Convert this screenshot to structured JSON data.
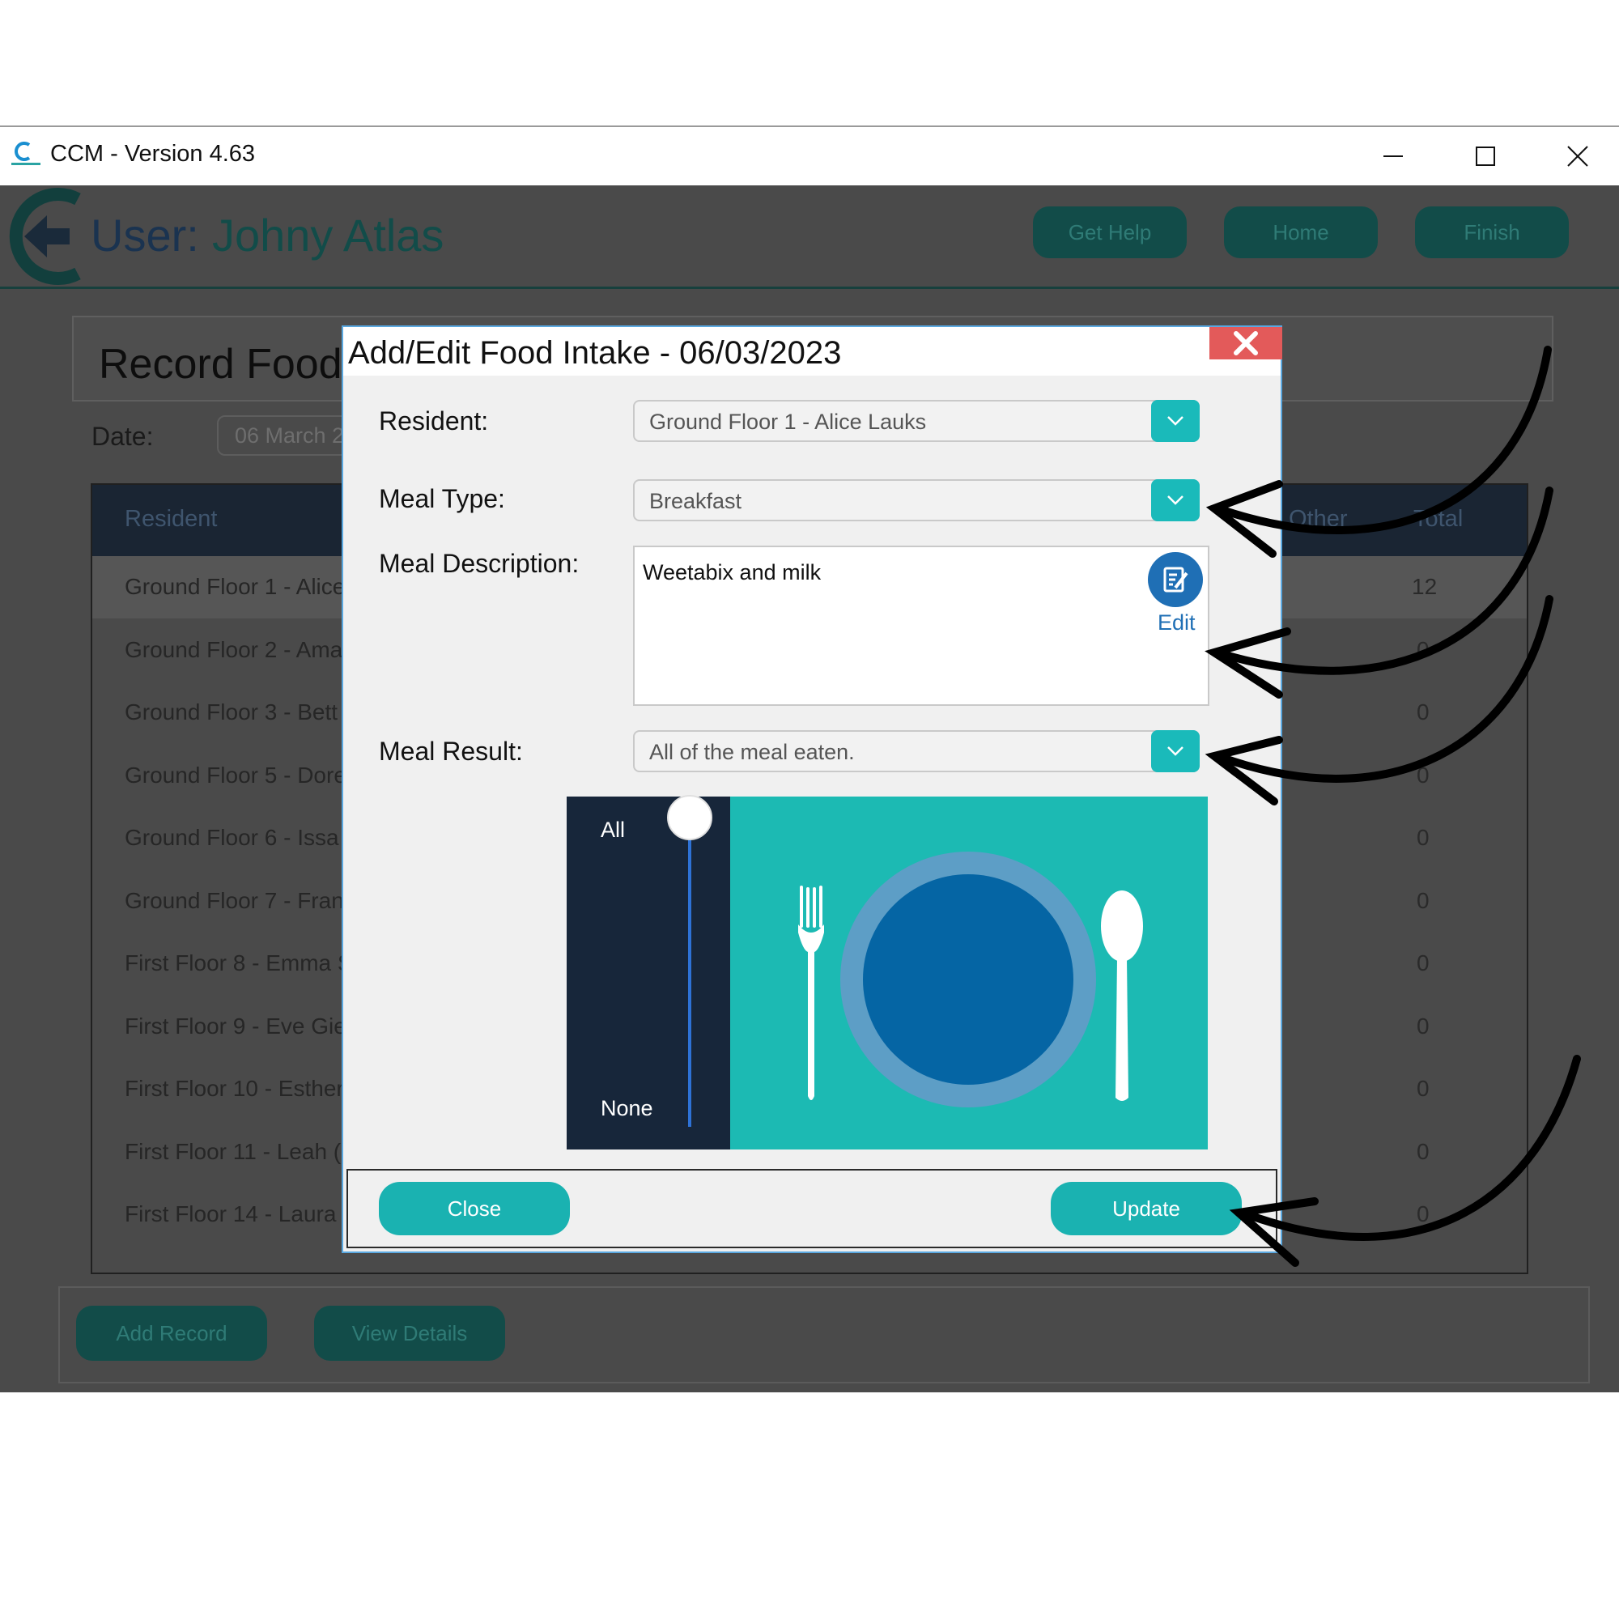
{
  "window": {
    "title": "CCM - Version 4.63",
    "controls": [
      "minimize-icon",
      "maximize-icon",
      "close-icon"
    ]
  },
  "header": {
    "user_label": "User:",
    "user_name": "Johny Atlas",
    "buttons": [
      "Get Help",
      "Home",
      "Finish"
    ]
  },
  "page": {
    "title": "Record Food",
    "date_label": "Date:",
    "date_value": "06 March 2"
  },
  "table": {
    "columns": {
      "resident": "Resident",
      "other": "Other",
      "total": "Total"
    },
    "rows": [
      {
        "name": "Ground Floor 1 - Alice",
        "total": "12"
      },
      {
        "name": "Ground Floor 2 - Ama",
        "total": "0"
      },
      {
        "name": "Ground Floor 3 - Bett",
        "total": "0"
      },
      {
        "name": "Ground Floor 5 - Dore",
        "total": "0"
      },
      {
        "name": "Ground Floor 6 - Issa",
        "total": "0"
      },
      {
        "name": "Ground Floor 7 - Fran",
        "total": "0"
      },
      {
        "name": "First Floor 8 - Emma S",
        "total": "0"
      },
      {
        "name": "First Floor 9 - Eve Gie",
        "total": "0"
      },
      {
        "name": "First Floor 10 - Esther",
        "total": "0"
      },
      {
        "name": "First Floor 11 - Leah (",
        "total": "0"
      },
      {
        "name": "First Floor 14 - Laura",
        "total": "0"
      }
    ]
  },
  "bottom_buttons": [
    "Add Record",
    "View Details"
  ],
  "modal": {
    "title": "Add/Edit Food Intake - 06/03/2023",
    "resident_label": "Resident:",
    "resident_value": "Ground Floor 1 - Alice Lauks",
    "meal_type_label": "Meal Type:",
    "meal_type_value": "Breakfast",
    "meal_description_label": "Meal Description:",
    "meal_description_value": "Weetabix and milk",
    "edit_label": "Edit",
    "meal_result_label": "Meal Result:",
    "meal_result_value": "All of the meal eaten.",
    "slider": {
      "top_label": "All",
      "bottom_label": "None",
      "level": 1.0
    },
    "close_button": "Close",
    "update_button": "Update"
  },
  "colors": {
    "accent_teal": "#1ab2b1",
    "dark_teal": "#124c49",
    "plate_blue": "#0565a4",
    "close_red": "#e35a5a"
  }
}
